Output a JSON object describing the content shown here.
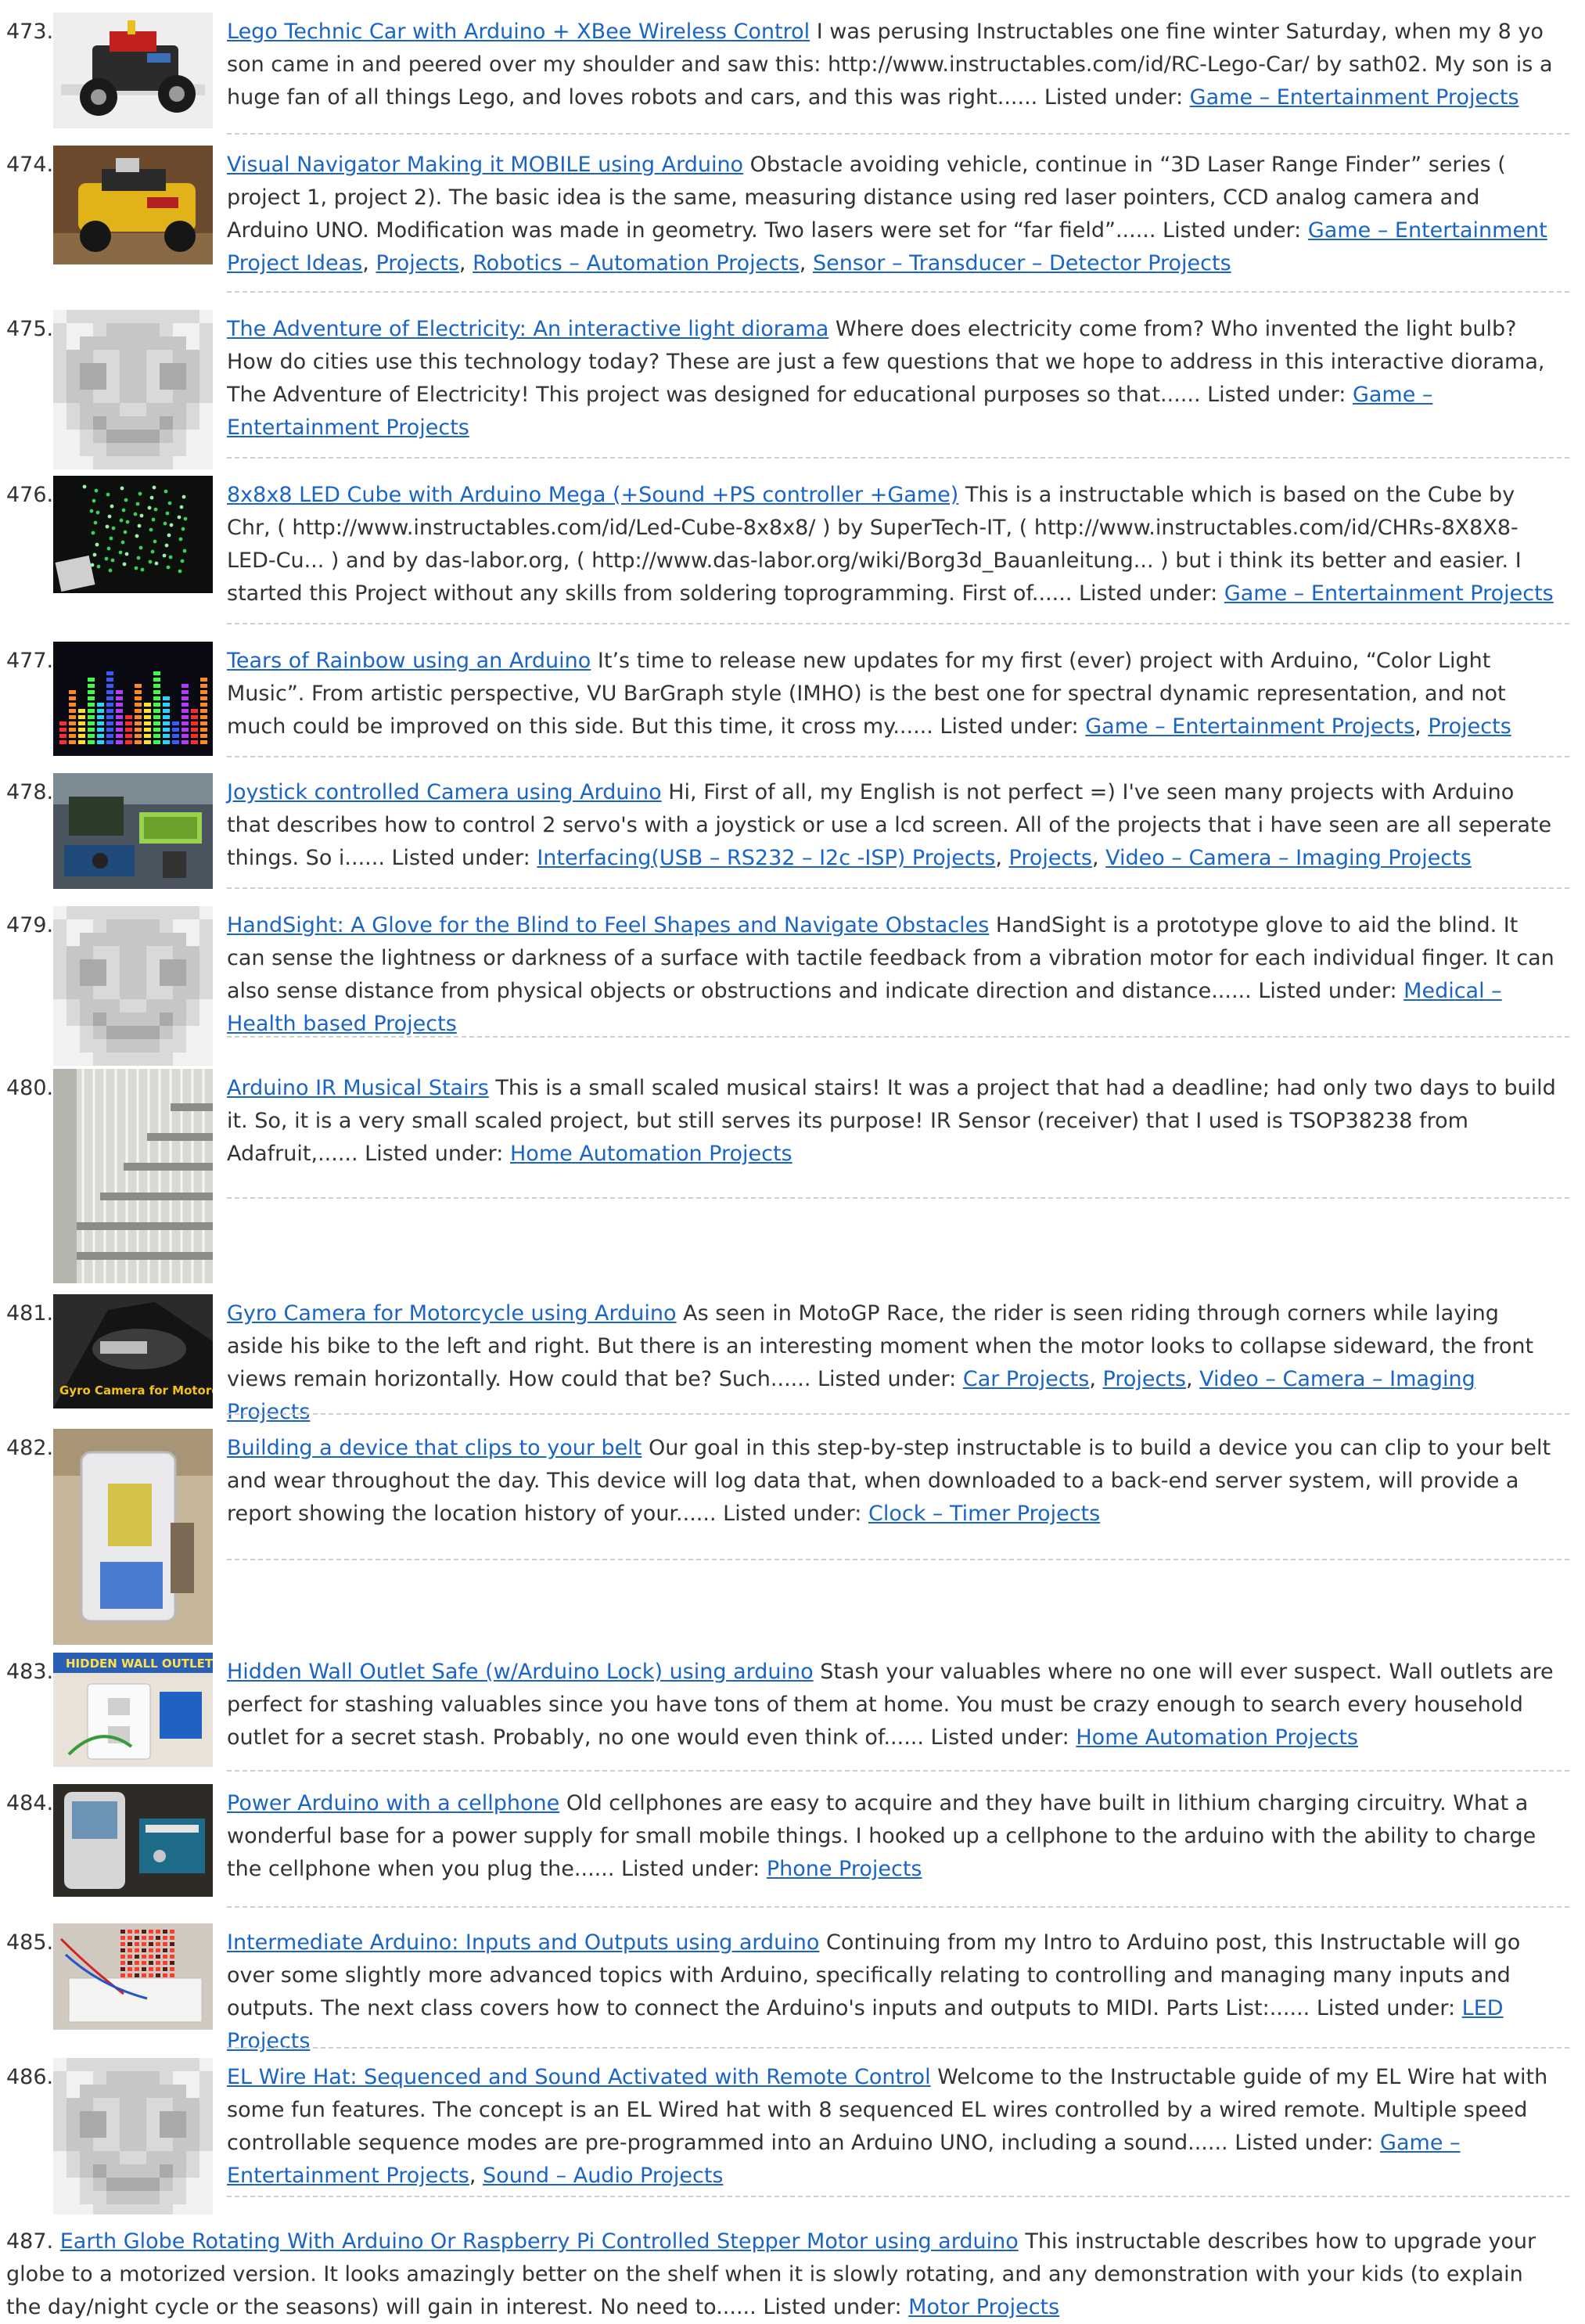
{
  "colors": {
    "link": "#1a64c8",
    "text": "#333333",
    "separator": "#cfcfcf"
  },
  "entries": [
    {
      "number": "473.",
      "title": "Lego Technic Car with Arduino + XBee Wireless Control",
      "description": "I was perusing Instructables one fine winter Saturday, when my 8 yo son came in and peered over my shoulder and saw this: http://www.instructables.com/id/RC-Lego-Car/ by sath02. My son is a huge fan of all things Lego, and loves robots and cars, and this was right......",
      "listed_label": "Listed under:",
      "categories": [
        "Game – Entertainment Projects"
      ],
      "thumb": "lego-car"
    },
    {
      "number": "474.",
      "title": "Visual Navigator Making it MOBILE using Arduino",
      "description": "Obstacle avoiding vehicle, continue in “3D Laser Range Finder” series ( project 1, project 2). The basic idea is the same, measuring distance using red laser pointers, CCD analog camera and Arduino UNO.  Modification was made in geometry.  Two lasers were set for “far field”......",
      "listed_label": "Listed under:",
      "categories": [
        "Game – Entertainment Project Ideas",
        "Projects",
        "Robotics – Automation Projects",
        "Sensor – Transducer – Detector Projects"
      ],
      "thumb": "yellow-vehicle"
    },
    {
      "number": "475.",
      "title": "The Adventure of Electricity: An interactive light diorama",
      "description": "Where does electricity come from? Who invented the light bulb? How do cities use this technology today? These are just a few questions that we hope to address in this interactive diorama, The Adventure of Electricity! This project was designed for educational purposes so that......",
      "listed_label": "Listed under:",
      "categories": [
        "Game – Entertainment Projects"
      ],
      "thumb": "placeholder"
    },
    {
      "number": "476.",
      "title": "8x8x8 LED Cube with Arduino Mega (+Sound +PS controller +Game)",
      "description": "This is a instructable which is based on the Cube by Chr, ( http://www.instructables.com/id/Led-Cube-8x8x8/ ) by SuperTech-IT, ( http://www.instructables.com/id/CHRs-8X8X8-LED-Cu... ) and by das-labor.org, ( http://www.das-labor.org/wiki/Borg3d_Bauanleitung... ) but i think its better and easier. I started this Project without any skills from soldering toprogramming. First of......",
      "listed_label": "Listed under:",
      "categories": [
        "Game – Entertainment Projects"
      ],
      "thumb": "led-cube"
    },
    {
      "number": "477.",
      "title": "Tears of Rainbow using an Arduino",
      "description": "It’s time to release new updates for my first (ever) project with Arduino, “Color Light Music”.  From artistic perspective, VU BarGraph style (IMHO) is the best one for spectral dynamic representation, and not much could be improved on this side. But this time, it cross my......",
      "listed_label": "Listed under:",
      "categories": [
        "Game – Entertainment Projects",
        "Projects"
      ],
      "thumb": "rainbow-bars"
    },
    {
      "number": "478.",
      "title": "Joystick controlled Camera using Arduino",
      "description": "Hi, First of all, my English is not perfect =) I've seen many projects with Arduino that describes how to control 2 servo's with a joystick or use a lcd screen. All of the projects that i have seen are all seperate things. So i......",
      "listed_label": "Listed under:",
      "categories": [
        "Interfacing(USB – RS232 – I2c -ISP) Projects",
        "Projects",
        "Video – Camera – Imaging Projects"
      ],
      "thumb": "joystick-camera"
    },
    {
      "number": "479.",
      "title": "HandSight: A Glove for the Blind to Feel Shapes and Navigate Obstacles",
      "description": "HandSight is a prototype glove to aid the blind. It can sense the lightness or darkness of a surface with tactile feedback from a vibration motor for each individual finger. It can also sense distance from physical objects or obstructions and indicate direction and distance......",
      "listed_label": "Listed under:",
      "categories": [
        "Medical – Health based Projects"
      ],
      "thumb": "placeholder"
    },
    {
      "number": "480.",
      "title": "Arduino IR Musical Stairs",
      "description": "This is a small scaled musical stairs! It was a project that had a deadline; had only two days to build it. So, it is a very small scaled project, but still serves its purpose! IR Sensor (receiver) that I used is TSOP38238 from Adafruit,......",
      "listed_label": "Listed under:",
      "categories": [
        "Home Automation Projects"
      ],
      "thumb": "stairs"
    },
    {
      "number": "481.",
      "title": "Gyro Camera for Motorcycle using Arduino",
      "description": "As seen in MotoGP Race, the rider is seen riding through corners while laying aside his bike to the left and right. But there is an interesting moment when the motor looks to collapse sideward, the front views remain horizontally. How could that be? Such......",
      "listed_label": "Listed under:",
      "categories": [
        "Car Projects",
        "Projects",
        "Video – Camera – Imaging Projects"
      ],
      "thumb": "motorcycle",
      "thumb_caption": "Gyro Camera for Motorcycle"
    },
    {
      "number": "482.",
      "title": "Building a device that clips to your belt",
      "description": "Our goal in this step-by-step instructable is to build a device you can clip to your belt and wear throughout the day. This device will log data that, when downloaded to a back-end server system, will provide a report showing the location history of your......",
      "listed_label": "Listed under:",
      "categories": [
        "Clock – Timer Projects"
      ],
      "thumb": "belt-device"
    },
    {
      "number": "483.",
      "title": "Hidden Wall Outlet Safe (w/Arduino Lock) using arduino",
      "description": "Stash your valuables where no one will ever suspect. Wall outlets are perfect for stashing valuables since you have tons of them at home. You must be crazy enough to search every household outlet for a secret stash. Probably, no one would even think of......",
      "listed_label": "Listed under:",
      "categories": [
        "Home Automation Projects"
      ],
      "thumb": "wall-outlet",
      "thumb_caption": "HIDDEN WALL OUTLET"
    },
    {
      "number": "484.",
      "title": "Power Arduino with a cellphone",
      "description": "Old cellphones are easy to acquire and they have built in lithium charging circuitry. What a wonderful base for a power supply for small mobile things. I hooked up a cellphone to the arduino with the ability to charge the cellphone when you plug the......",
      "listed_label": "Listed under:",
      "categories": [
        "Phone Projects"
      ],
      "thumb": "cellphone"
    },
    {
      "number": "485.",
      "title": "Intermediate Arduino: Inputs and Outputs using arduino",
      "description": "Continuing from my Intro to Arduino post, this Instructable will go over some slightly more advanced topics with Arduino, specifically relating to controlling and managing many inputs and outputs. The next class covers how to connect the Arduino's inputs and outputs to MIDI. Parts List:......",
      "listed_label": "Listed under:",
      "categories": [
        "LED Projects"
      ],
      "thumb": "breadboard"
    },
    {
      "number": "486.",
      "title": "EL Wire Hat: Sequenced and Sound Activated with Remote Control",
      "description": "Welcome to the Instructable guide of my EL Wire hat with some fun features. The concept is an EL Wired hat with 8 sequenced EL wires controlled by a wired remote. Multiple speed controllable sequence modes are pre-programmed into an Arduino UNO, including a sound......",
      "listed_label": "Listed under:",
      "categories": [
        "Game – Entertainment Projects",
        "Sound – Audio Projects"
      ],
      "thumb": "placeholder"
    },
    {
      "number": "487.",
      "title": "Earth Globe Rotating With Arduino Or Raspberry Pi Controlled Stepper Motor using arduino",
      "description": "This instructable describes how to upgrade your globe to a motorized version. It looks amazingly better on the shelf when it is slowly rotating, and any demonstration with your kids (to explain the day/night cycle or the seasons) will gain in interest. No need to......",
      "listed_label": "Listed under:",
      "categories": [
        "Motor Projects"
      ],
      "thumb": "none"
    }
  ]
}
